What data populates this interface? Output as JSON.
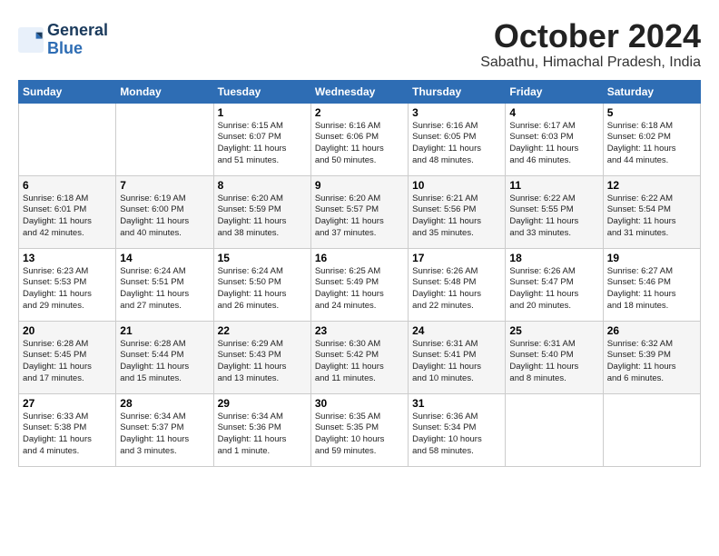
{
  "logo": {
    "line1": "General",
    "line2": "Blue"
  },
  "title": "October 2024",
  "location": "Sabathu, Himachal Pradesh, India",
  "weekdays": [
    "Sunday",
    "Monday",
    "Tuesday",
    "Wednesday",
    "Thursday",
    "Friday",
    "Saturday"
  ],
  "weeks": [
    [
      {
        "day": "",
        "info": ""
      },
      {
        "day": "",
        "info": ""
      },
      {
        "day": "1",
        "info": "Sunrise: 6:15 AM\nSunset: 6:07 PM\nDaylight: 11 hours\nand 51 minutes."
      },
      {
        "day": "2",
        "info": "Sunrise: 6:16 AM\nSunset: 6:06 PM\nDaylight: 11 hours\nand 50 minutes."
      },
      {
        "day": "3",
        "info": "Sunrise: 6:16 AM\nSunset: 6:05 PM\nDaylight: 11 hours\nand 48 minutes."
      },
      {
        "day": "4",
        "info": "Sunrise: 6:17 AM\nSunset: 6:03 PM\nDaylight: 11 hours\nand 46 minutes."
      },
      {
        "day": "5",
        "info": "Sunrise: 6:18 AM\nSunset: 6:02 PM\nDaylight: 11 hours\nand 44 minutes."
      }
    ],
    [
      {
        "day": "6",
        "info": "Sunrise: 6:18 AM\nSunset: 6:01 PM\nDaylight: 11 hours\nand 42 minutes."
      },
      {
        "day": "7",
        "info": "Sunrise: 6:19 AM\nSunset: 6:00 PM\nDaylight: 11 hours\nand 40 minutes."
      },
      {
        "day": "8",
        "info": "Sunrise: 6:20 AM\nSunset: 5:59 PM\nDaylight: 11 hours\nand 38 minutes."
      },
      {
        "day": "9",
        "info": "Sunrise: 6:20 AM\nSunset: 5:57 PM\nDaylight: 11 hours\nand 37 minutes."
      },
      {
        "day": "10",
        "info": "Sunrise: 6:21 AM\nSunset: 5:56 PM\nDaylight: 11 hours\nand 35 minutes."
      },
      {
        "day": "11",
        "info": "Sunrise: 6:22 AM\nSunset: 5:55 PM\nDaylight: 11 hours\nand 33 minutes."
      },
      {
        "day": "12",
        "info": "Sunrise: 6:22 AM\nSunset: 5:54 PM\nDaylight: 11 hours\nand 31 minutes."
      }
    ],
    [
      {
        "day": "13",
        "info": "Sunrise: 6:23 AM\nSunset: 5:53 PM\nDaylight: 11 hours\nand 29 minutes."
      },
      {
        "day": "14",
        "info": "Sunrise: 6:24 AM\nSunset: 5:51 PM\nDaylight: 11 hours\nand 27 minutes."
      },
      {
        "day": "15",
        "info": "Sunrise: 6:24 AM\nSunset: 5:50 PM\nDaylight: 11 hours\nand 26 minutes."
      },
      {
        "day": "16",
        "info": "Sunrise: 6:25 AM\nSunset: 5:49 PM\nDaylight: 11 hours\nand 24 minutes."
      },
      {
        "day": "17",
        "info": "Sunrise: 6:26 AM\nSunset: 5:48 PM\nDaylight: 11 hours\nand 22 minutes."
      },
      {
        "day": "18",
        "info": "Sunrise: 6:26 AM\nSunset: 5:47 PM\nDaylight: 11 hours\nand 20 minutes."
      },
      {
        "day": "19",
        "info": "Sunrise: 6:27 AM\nSunset: 5:46 PM\nDaylight: 11 hours\nand 18 minutes."
      }
    ],
    [
      {
        "day": "20",
        "info": "Sunrise: 6:28 AM\nSunset: 5:45 PM\nDaylight: 11 hours\nand 17 minutes."
      },
      {
        "day": "21",
        "info": "Sunrise: 6:28 AM\nSunset: 5:44 PM\nDaylight: 11 hours\nand 15 minutes."
      },
      {
        "day": "22",
        "info": "Sunrise: 6:29 AM\nSunset: 5:43 PM\nDaylight: 11 hours\nand 13 minutes."
      },
      {
        "day": "23",
        "info": "Sunrise: 6:30 AM\nSunset: 5:42 PM\nDaylight: 11 hours\nand 11 minutes."
      },
      {
        "day": "24",
        "info": "Sunrise: 6:31 AM\nSunset: 5:41 PM\nDaylight: 11 hours\nand 10 minutes."
      },
      {
        "day": "25",
        "info": "Sunrise: 6:31 AM\nSunset: 5:40 PM\nDaylight: 11 hours\nand 8 minutes."
      },
      {
        "day": "26",
        "info": "Sunrise: 6:32 AM\nSunset: 5:39 PM\nDaylight: 11 hours\nand 6 minutes."
      }
    ],
    [
      {
        "day": "27",
        "info": "Sunrise: 6:33 AM\nSunset: 5:38 PM\nDaylight: 11 hours\nand 4 minutes."
      },
      {
        "day": "28",
        "info": "Sunrise: 6:34 AM\nSunset: 5:37 PM\nDaylight: 11 hours\nand 3 minutes."
      },
      {
        "day": "29",
        "info": "Sunrise: 6:34 AM\nSunset: 5:36 PM\nDaylight: 11 hours\nand 1 minute."
      },
      {
        "day": "30",
        "info": "Sunrise: 6:35 AM\nSunset: 5:35 PM\nDaylight: 10 hours\nand 59 minutes."
      },
      {
        "day": "31",
        "info": "Sunrise: 6:36 AM\nSunset: 5:34 PM\nDaylight: 10 hours\nand 58 minutes."
      },
      {
        "day": "",
        "info": ""
      },
      {
        "day": "",
        "info": ""
      }
    ]
  ]
}
